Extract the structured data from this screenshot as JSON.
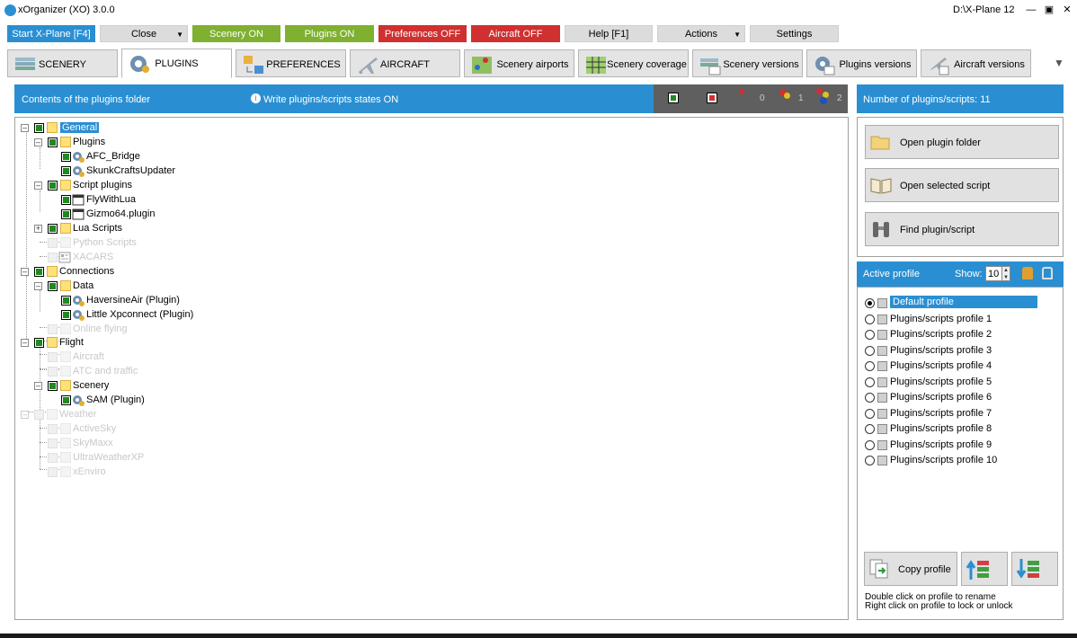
{
  "window": {
    "title": "xOrganizer (XO) 3.0.0",
    "xplane_path": "D:\\X-Plane 12"
  },
  "toolbar": {
    "start": "Start X-Plane [F4]",
    "close": "Close",
    "scenery_on": "Scenery ON",
    "plugins_on": "Plugins ON",
    "preferences_off": "Preferences OFF",
    "aircraft_off": "Aircraft OFF",
    "help": "Help [F1]",
    "actions": "Actions",
    "settings": "Settings"
  },
  "tabs": [
    {
      "label": "SCENERY"
    },
    {
      "label": "PLUGINS"
    },
    {
      "label": "PREFERENCES"
    },
    {
      "label": "AIRCRAFT"
    },
    {
      "label": "Scenery airports"
    },
    {
      "label": "Scenery coverage"
    },
    {
      "label": "Scenery versions"
    },
    {
      "label": "Plugins versions"
    },
    {
      "label": "Aircraft versions"
    }
  ],
  "plugins_panel": {
    "header": "Contents of the plugins folder",
    "write_states": "Write plugins/scripts states ON",
    "legend_counts": {
      "c0": "0",
      "c1": "1",
      "c2": "2"
    }
  },
  "tree": [
    {
      "label": "General"
    },
    {
      "label": "Plugins"
    },
    {
      "label": "AFC_Bridge"
    },
    {
      "label": "SkunkCraftsUpdater"
    },
    {
      "label": "Script plugins"
    },
    {
      "label": "FlyWithLua"
    },
    {
      "label": "Gizmo64.plugin"
    },
    {
      "label": "Lua Scripts"
    },
    {
      "label": "Python Scripts"
    },
    {
      "label": "XACARS"
    },
    {
      "label": "Connections"
    },
    {
      "label": "Data"
    },
    {
      "label": "HaversineAir (Plugin)"
    },
    {
      "label": "Little Xpconnect (Plugin)"
    },
    {
      "label": "Online flying"
    },
    {
      "label": "Flight"
    },
    {
      "label": "Aircraft"
    },
    {
      "label": "ATC and traffic"
    },
    {
      "label": "Scenery"
    },
    {
      "label": "SAM (Plugin)"
    },
    {
      "label": "Weather"
    },
    {
      "label": "ActiveSky"
    },
    {
      "label": "SkyMaxx"
    },
    {
      "label": "UltraWeatherXP"
    },
    {
      "label": "xEnviro"
    }
  ],
  "right_panel": {
    "count_label": "Number of plugins/scripts: 11",
    "open_folder": "Open plugin folder",
    "open_script": "Open selected script",
    "find": "Find plugin/script"
  },
  "profiles": {
    "header": "Active profile",
    "show_label": "Show:",
    "show_value": "10",
    "items": [
      "Default profile",
      "Plugins/scripts profile 1",
      "Plugins/scripts profile 2",
      "Plugins/scripts profile 3",
      "Plugins/scripts profile 4",
      "Plugins/scripts profile 5",
      "Plugins/scripts profile 6",
      "Plugins/scripts profile 7",
      "Plugins/scripts profile 8",
      "Plugins/scripts profile 9",
      "Plugins/scripts profile 10"
    ],
    "copy": "Copy profile",
    "hint1": "Double click on profile to rename",
    "hint2": "Right click on profile to lock or unlock"
  }
}
